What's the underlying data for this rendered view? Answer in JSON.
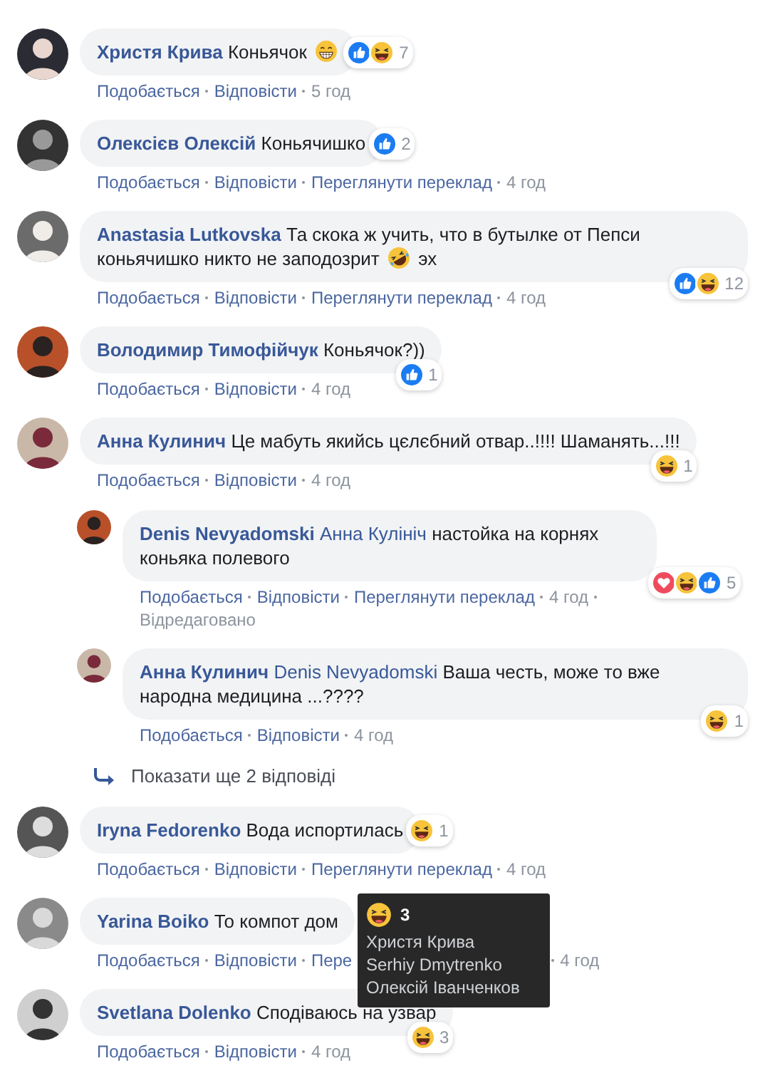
{
  "comments": [
    {
      "author": "Христя Крива",
      "parts": [
        {
          "kind": "text",
          "text": "Коньячок"
        },
        {
          "kind": "grin"
        }
      ],
      "reactions": {
        "kind": "side",
        "icons": [
          {
            "kind": "like"
          },
          {
            "kind": "haha"
          }
        ],
        "count": "7"
      },
      "actions": [
        "Подобається",
        "Відповісти"
      ],
      "time": "5 год"
    },
    {
      "author": "Олексієв Олексій",
      "parts": [
        {
          "kind": "text",
          "text": "Коньячишко"
        }
      ],
      "reactions": {
        "kind": "side",
        "icons": [
          {
            "kind": "like"
          }
        ],
        "count": "2"
      },
      "actions": [
        "Подобається",
        "Відповісти",
        "Переглянути переклад"
      ],
      "time": "4 год"
    },
    {
      "author": "Anastasia Lutkovska",
      "parts": [
        {
          "kind": "text",
          "text": "Та скока ж учить, что в бутылке от Пепси коньячишко никто не заподозрит"
        },
        {
          "kind": "rofl"
        },
        {
          "kind": "text",
          "text": "эх"
        }
      ],
      "reactions": {
        "kind": "corner",
        "icons": [
          {
            "kind": "like"
          },
          {
            "kind": "haha"
          }
        ],
        "count": "12"
      },
      "actions": [
        "Подобається",
        "Відповісти",
        "Переглянути переклад"
      ],
      "time": "4 год"
    },
    {
      "author": "Володимир Тимофійчук",
      "parts": [
        {
          "kind": "text",
          "text": "Коньячок?))"
        }
      ],
      "reactions": {
        "kind": "corner",
        "icons": [
          {
            "kind": "like"
          }
        ],
        "count": "1"
      },
      "actions": [
        "Подобається",
        "Відповісти"
      ],
      "time": "4 год"
    },
    {
      "author": "Анна Кулинич",
      "parts": [
        {
          "kind": "text",
          "text": "Це мабуть якийсь цєлєбний отвар..!!!! Шаманять...!!!"
        }
      ],
      "reactions": {
        "kind": "corner",
        "icons": [
          {
            "kind": "haha"
          }
        ],
        "count": "1"
      },
      "actions": [
        "Подобається",
        "Відповісти"
      ],
      "time": "4 год",
      "replies": [
        {
          "author": "Denis Nevyadomski",
          "parts": [
            {
              "kind": "mention",
              "text": "Анна Кулініч"
            },
            {
              "kind": "text",
              "text": "настойка на корнях коньяка полевого"
            }
          ],
          "reactions": {
            "kind": "side_low",
            "icons": [
              {
                "kind": "love"
              },
              {
                "kind": "haha"
              },
              {
                "kind": "like"
              }
            ],
            "count": "5"
          },
          "actions": [
            "Подобається",
            "Відповісти",
            "Переглянути переклад"
          ],
          "time": "4 год",
          "edited": "Відредаговано"
        },
        {
          "author": "Анна Кулинич",
          "parts": [
            {
              "kind": "mention",
              "text": "Denis Nevyadomski"
            },
            {
              "kind": "text",
              "text": "Ваша честь, може то вже народна медицина ...????"
            }
          ],
          "reactions": {
            "kind": "corner",
            "icons": [
              {
                "kind": "haha"
              }
            ],
            "count": "1"
          },
          "actions": [
            "Подобається",
            "Відповісти"
          ],
          "time": "4 год"
        }
      ],
      "more_replies": "Показати ще 2 відповіді"
    },
    {
      "author": "Iryna Fedorenko",
      "parts": [
        {
          "kind": "text",
          "text": "Вода испортилась"
        }
      ],
      "reactions": {
        "kind": "side",
        "icons": [
          {
            "kind": "haha"
          }
        ],
        "count": "1"
      },
      "actions": [
        "Подобається",
        "Відповісти",
        "Переглянути переклад"
      ],
      "time": "4 год"
    },
    {
      "author": "Yarina Boiko",
      "parts": [
        {
          "kind": "text",
          "text": "То компот дом"
        }
      ],
      "actions": [
        "Подобається",
        "Відповісти",
        "Пере"
      ],
      "time": "4 год",
      "tooltip": {
        "kind": "haha",
        "count": "3",
        "names": [
          "Христя Крива",
          "Serhiy Dmytrenko",
          "Олексій Іванченков"
        ]
      }
    },
    {
      "author": "Svetlana Dolenko",
      "parts": [
        {
          "kind": "text",
          "text": "Сподіваюсь на узвар"
        }
      ],
      "reactions": {
        "kind": "corner",
        "icons": [
          {
            "kind": "haha"
          }
        ],
        "count": "3"
      },
      "actions": [
        "Подобається",
        "Відповісти"
      ],
      "time": "4 год"
    }
  ]
}
